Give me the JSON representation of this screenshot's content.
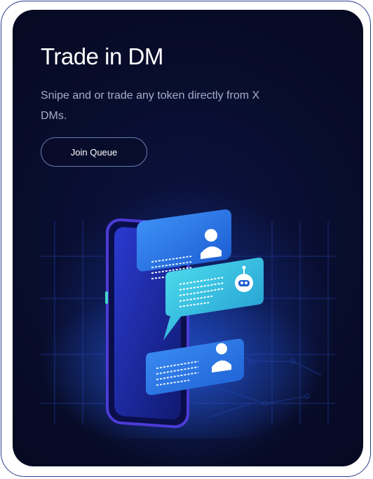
{
  "hero": {
    "title": "Trade in DM",
    "subtitle": "Snipe and or trade any token directly from X DMs.",
    "cta_label": "Join Queue"
  },
  "illustration": {
    "bubbles": [
      {
        "sender": "user",
        "icon": "user-icon"
      },
      {
        "sender": "bot",
        "icon": "robot-icon"
      },
      {
        "sender": "user",
        "icon": "user-icon"
      }
    ]
  },
  "colors": {
    "card_background": "#070b26",
    "accent_blue": "#2f8ff0",
    "accent_cyan": "#3ad0e8",
    "border": "#2b3a8f"
  }
}
